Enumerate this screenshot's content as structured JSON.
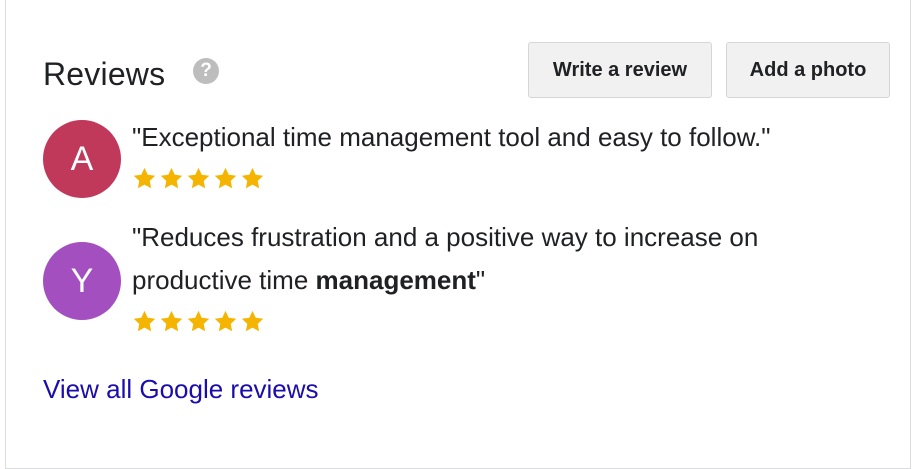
{
  "header": {
    "title": "Reviews",
    "help_icon": "question-circle-icon",
    "help_glyph": "?"
  },
  "actions": {
    "write_review_label": "Write a review",
    "add_photo_label": "Add a photo"
  },
  "reviews": [
    {
      "avatar_letter": "A",
      "avatar_color": "#c0385a",
      "text_prefix": "\"Exceptional time management tool and easy to follow.\"",
      "rating": 5,
      "max_rating": 5
    },
    {
      "avatar_letter": "Y",
      "avatar_color": "#a34fc0",
      "text_line1": "\"Reduces frustration and a positive way to increase on",
      "text_line2_prefix": "productive time ",
      "text_line2_bold": "management",
      "text_line2_suffix": "\"",
      "rating": 5,
      "max_rating": 5
    }
  ],
  "footer": {
    "link_label": "View all Google reviews"
  },
  "colors": {
    "star": "#f4b400",
    "link": "#1a0dab",
    "help_icon_bg": "#bdbdbd",
    "button_bg": "#f1f1f1"
  }
}
